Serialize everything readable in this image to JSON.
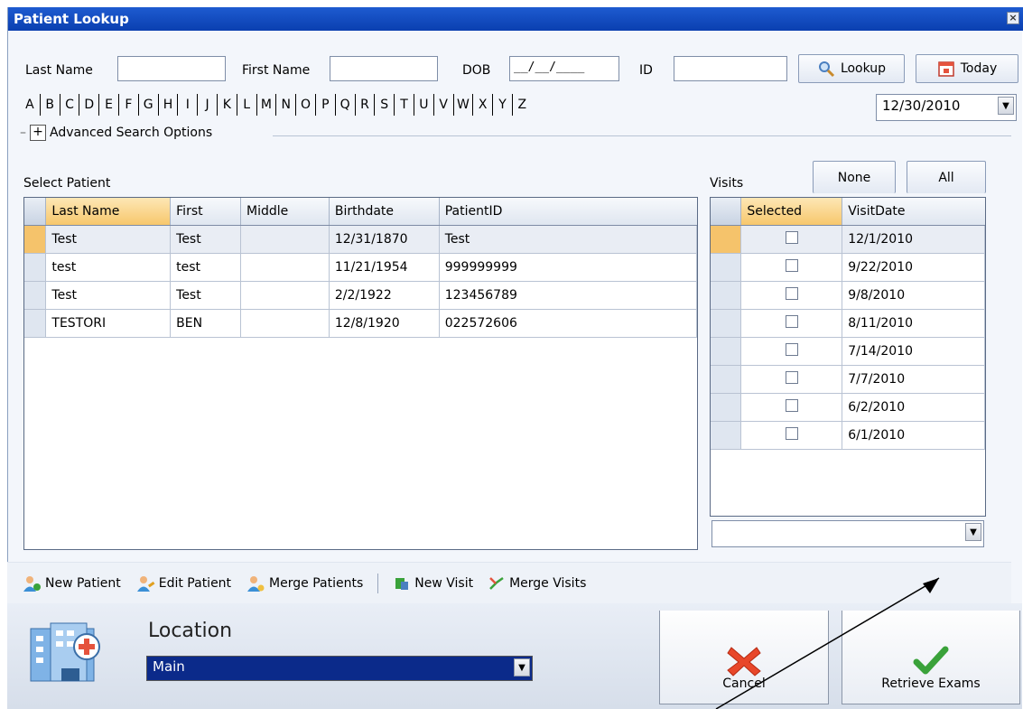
{
  "window": {
    "title": "Patient Lookup",
    "close_glyph": "×"
  },
  "search": {
    "last_name_label": "Last Name",
    "last_name_value": "",
    "first_name_label": "First Name",
    "first_name_value": "",
    "dob_label": "DOB",
    "dob_mask": "__/__/____",
    "id_label": "ID",
    "id_value": "",
    "lookup_label": "Lookup",
    "today_label": "Today",
    "letters": [
      "A",
      "B",
      "C",
      "D",
      "E",
      "F",
      "G",
      "H",
      "I",
      "J",
      "K",
      "L",
      "M",
      "N",
      "O",
      "P",
      "Q",
      "R",
      "S",
      "T",
      "U",
      "V",
      "W",
      "X",
      "Y",
      "Z"
    ],
    "date_value": "12/30/2010",
    "advanced_label": "Advanced Search Options",
    "plus_glyph": "+"
  },
  "patients": {
    "title": "Select Patient",
    "columns": [
      "Last Name",
      "First",
      "Middle",
      "Birthdate",
      "PatientID"
    ],
    "rows": [
      [
        "Test",
        "Test",
        "",
        "12/31/1870",
        "Test"
      ],
      [
        "test",
        "test",
        "",
        "11/21/1954",
        "999999999"
      ],
      [
        "Test",
        "Test",
        "",
        "2/2/1922",
        "123456789"
      ],
      [
        "TESTORI",
        "BEN",
        "",
        "12/8/1920",
        "022572606"
      ]
    ]
  },
  "visits": {
    "title": "Visits",
    "none_label": "None",
    "all_label": "All",
    "columns": [
      "Selected",
      "VisitDate"
    ],
    "rows": [
      {
        "selected": false,
        "date": "12/1/2010"
      },
      {
        "selected": false,
        "date": "9/22/2010"
      },
      {
        "selected": false,
        "date": "9/8/2010"
      },
      {
        "selected": false,
        "date": "8/11/2010"
      },
      {
        "selected": false,
        "date": "7/14/2010"
      },
      {
        "selected": false,
        "date": "7/7/2010"
      },
      {
        "selected": false,
        "date": "6/2/2010"
      },
      {
        "selected": false,
        "date": "6/1/2010"
      }
    ],
    "dropdown_value": ""
  },
  "toolbar": {
    "new_patient": "New Patient",
    "edit_patient": "Edit Patient",
    "merge_patients": "Merge Patients",
    "new_visit": "New Visit",
    "merge_visits": "Merge Visits"
  },
  "footer": {
    "location_label": "Location",
    "location_value": "Main",
    "cancel_label": "Cancel",
    "retrieve_label": "Retrieve Exams"
  },
  "colors": {
    "titlebar": "#1e5bd0",
    "selected_header": "#f7c76c",
    "cancel_x": "#e8472a",
    "check": "#3aa23a"
  }
}
